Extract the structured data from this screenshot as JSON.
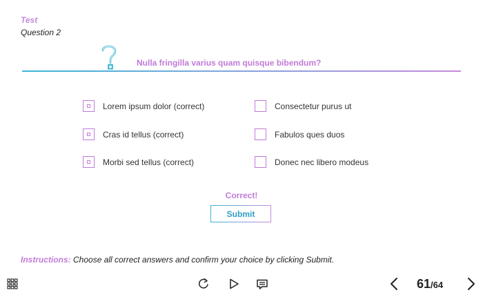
{
  "header": {
    "test_label": "Test",
    "question_number": "Question 2"
  },
  "question": {
    "text": "Nulla fringilla varius quam quisque bibendum?"
  },
  "options": [
    {
      "label": "Lorem ipsum dolor (correct)",
      "checked": true
    },
    {
      "label": "Consectetur purus ut",
      "checked": false
    },
    {
      "label": "Cras id tellus (correct)",
      "checked": true
    },
    {
      "label": "Fabulos ques duos",
      "checked": false
    },
    {
      "label": "Morbi sed tellus (correct)",
      "checked": true
    },
    {
      "label": "Donec nec libero modeus",
      "checked": false
    }
  ],
  "feedback": "Correct!",
  "submit_label": "Submit",
  "instructions": {
    "label": "Instructions:",
    "text": " Choose all correct answers and confirm your choice by clicking Submit."
  },
  "pagination": {
    "current": "61",
    "total": "/64"
  },
  "colors": {
    "accent_purple": "#c17ad8",
    "accent_blue": "#38b6d4"
  },
  "icons": {
    "menu": "grid-menu-icon",
    "replay": "replay-icon",
    "play": "play-icon",
    "notes": "notes-icon",
    "prev": "chevron-left-icon",
    "next": "chevron-right-icon",
    "question": "question-mark-icon"
  }
}
